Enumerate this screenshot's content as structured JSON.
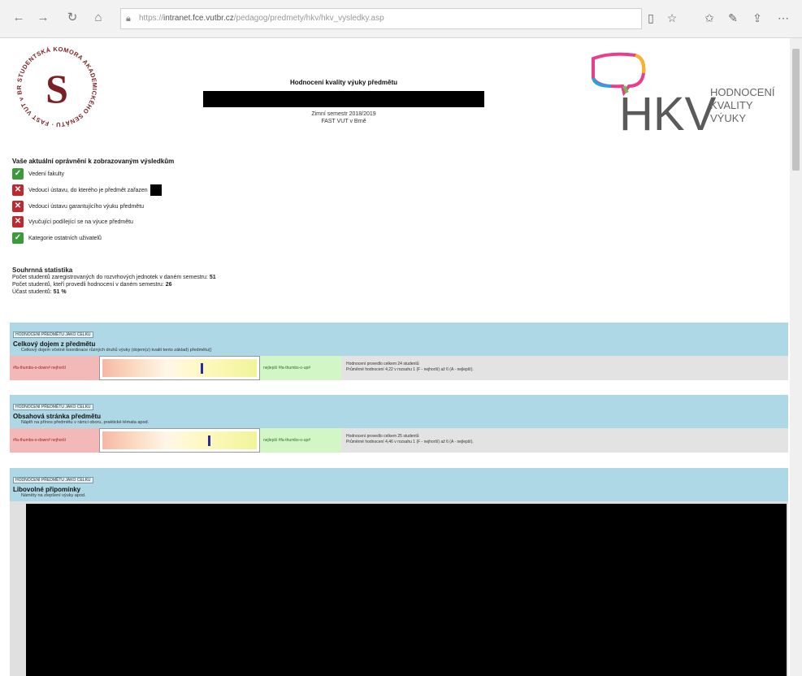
{
  "browser": {
    "url_prefix": "https://",
    "url_host": "intranet.fce.vutbr.cz",
    "url_path": "/pedagog/predmety/hkv/hkv_vysledky.asp"
  },
  "header": {
    "title": "Hodnocení kvality výuky předmětu",
    "term": "Zimní semestr 2018/2019",
    "faculty": "FAST VUT v Brně",
    "seal_text": "STUDENTSKÁ KOMORA AKADEMICKÉHO SENÁTU · FAST VUT v BRNĚ ·",
    "seal_letter": "S",
    "hkv_logo": {
      "letters": "HKV",
      "line1": "HODNOCENÍ",
      "line2": "KVALITY",
      "line3": "VÝUKY"
    }
  },
  "permissions": {
    "heading": "Vaše aktuální oprávnění k zobrazovaným výsledkům",
    "items": [
      {
        "label": "Vedení fakulty",
        "allowed": true,
        "icon": "check-icon"
      },
      {
        "label": "Vedoucí ústavu, do kterého je předmět zařazen",
        "allowed": false,
        "icon": "cross-icon"
      },
      {
        "label": "Vedoucí ústavu garantujícího výuku předmětu",
        "allowed": false,
        "icon": "cross-icon"
      },
      {
        "label": "Vyučující podílející se na výuce předmětu",
        "allowed": false,
        "icon": "cross-icon"
      },
      {
        "label": "Kategorie ostatních uživatelů",
        "allowed": true,
        "icon": "check-icon"
      }
    ]
  },
  "stats": {
    "heading": "Souhrnná statistika",
    "line1_label": "Počet studentů zaregistrovaných do rozvrhových jednotek v daném semestru:",
    "line1_value": "51",
    "line2_label": "Počet studentů, kteří provedli hodnocení v daném semestru:",
    "line2_value": "26",
    "line3_label": "Účast studentů:",
    "line3_value": "51 %"
  },
  "sections": [
    {
      "tag": "HODNOCENÍ PŘEDMĚTU JAKO CELKU",
      "title": "Celkový dojem z předmětu",
      "subtitle": "Celkový dojem včetně koordinace různých druhů výuky (dojem(z) kvalit tento základ) předmětu()",
      "worst_label": "#fa-thumbs-o-down# nejhorší",
      "best_label": "nejlepší #fa-thumbs-o-up#",
      "score": 0.64,
      "info_line1": "Hodnocení provedlo celkem 24 studentů",
      "info_line2": "Průměrné hodnocení 4,22 v rozsahu 1 (F - nejhorší) až 6 (A - nejlepší)."
    },
    {
      "tag": "HODNOCENÍ PŘEDMĚTU JAKO CELKU",
      "title": "Obsahová stránka předmětu",
      "subtitle": "Náplň na přínos předmětu v rámci oboru, praktické témata apod.",
      "worst_label": "#fa-thumbs-o-down# nejhorší",
      "best_label": "nejlepší #fa-thumbs-o-up#",
      "score": 0.69,
      "info_line1": "Hodnocení provedlo celkem 25 studentů",
      "info_line2": "Průměrné hodnocení 4,46 v rozsahu 1 (F - nejhorší) až 6 (A - nejlepší)."
    }
  ],
  "comments": {
    "tag": "HODNOCENÍ PŘEDMĚTU JAKO CELKU",
    "title": "Libovolné připomínky",
    "subtitle": "Náměty na zlepšení výuky apod."
  }
}
